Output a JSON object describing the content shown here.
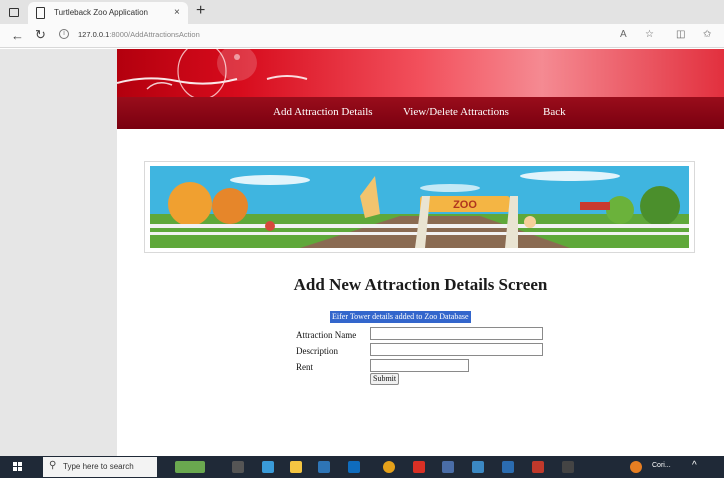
{
  "browser": {
    "tab_title": "Turtleback Zoo Application",
    "tab_close": "×",
    "new_tab": "+",
    "url_host": "127.0.0.1",
    "url_path": ":8000/AddAttractionsAction",
    "back": "←",
    "refresh": "↻",
    "info": "i"
  },
  "nav": {
    "add_label": "Add Attraction Details",
    "view_delete_label": "View/Delete Attractions",
    "back_label": "Back"
  },
  "banner_image": {
    "sign_text": "ZOO"
  },
  "page": {
    "title": "Add New Attraction Details Screen",
    "message": "Eifer Tower details added to Zoo Database"
  },
  "form": {
    "name_label": "Attraction Name",
    "description_label": "Description",
    "rent_label": "Rent",
    "name_value": "",
    "description_value": "",
    "rent_value": "",
    "submit_label": "Submit"
  },
  "taskbar": {
    "search_placeholder": "Type here to search",
    "tray_label": "Cori..."
  },
  "colors": {
    "banner_red": "#d70b1c",
    "menu_dark_red": "#8a0515",
    "message_highlight": "#3366cc",
    "sidebar_gray": "#e6e6e6",
    "taskbar": "#1f2937"
  },
  "icons": [
    "browser-tab-icon",
    "document-icon",
    "close-icon",
    "plus-icon",
    "back-arrow-icon",
    "refresh-icon",
    "info-icon",
    "read-aloud-icon",
    "star-icon",
    "split-screen-icon",
    "favorites-icon",
    "windows-start-icon",
    "search-icon"
  ]
}
